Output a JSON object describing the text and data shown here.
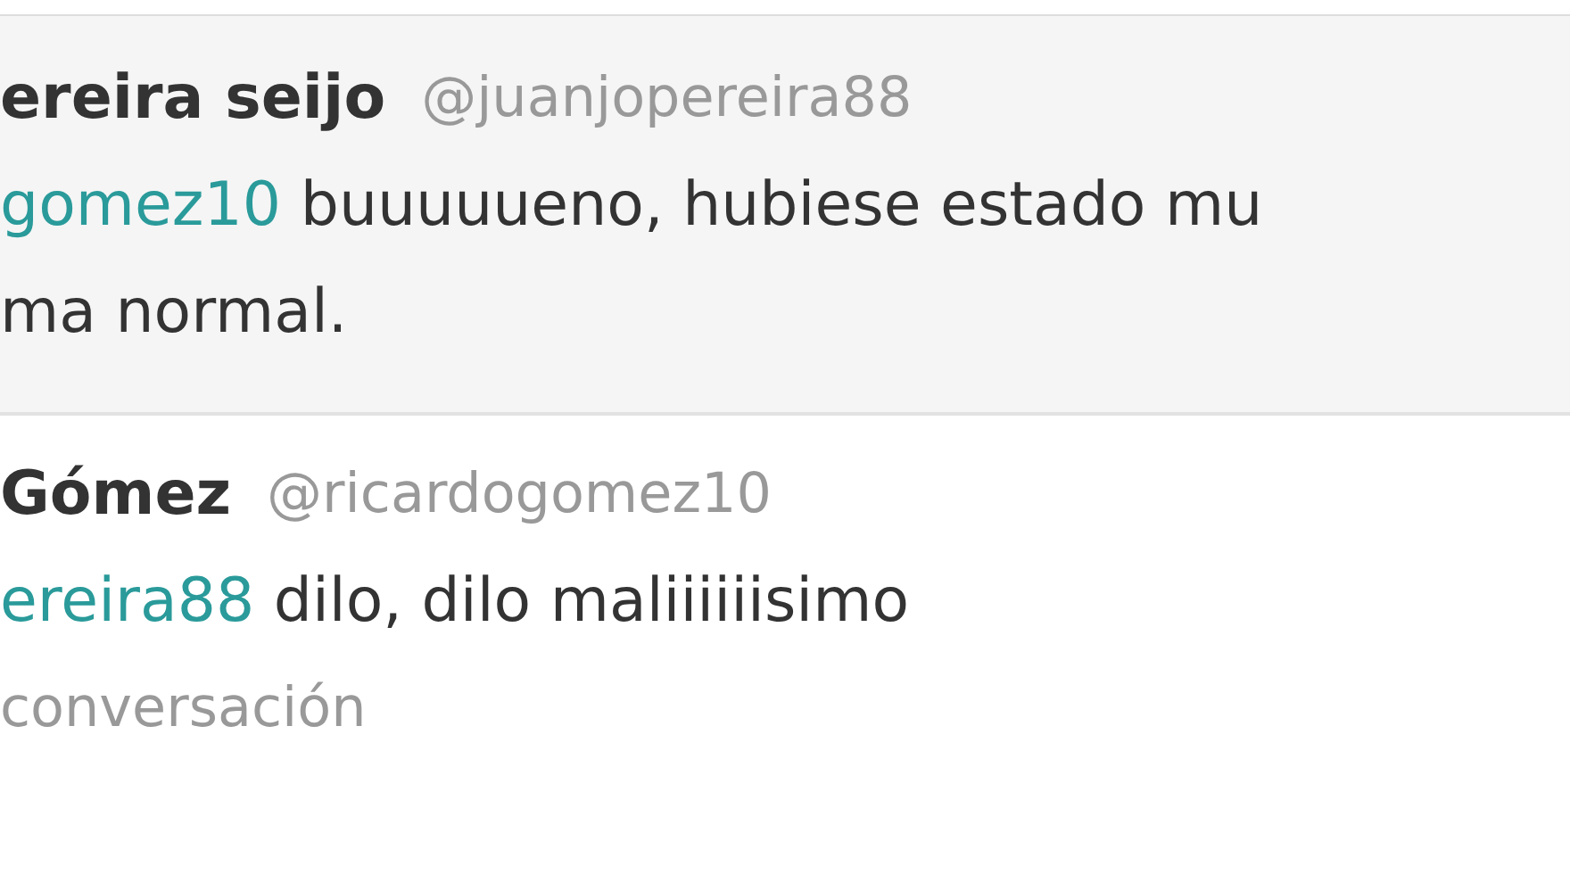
{
  "tweets": [
    {
      "highlighted": true,
      "name": "ereira seijo",
      "handle": "@juanjopereira88",
      "mention": "gomez10",
      "text_lines": [
        "buuuuueno, hubiese estado mu",
        "ma normal."
      ]
    },
    {
      "highlighted": false,
      "name": "Gómez",
      "handle": "@ricardogomez10",
      "mention": "ereira88",
      "text_lines": [
        "dilo, dilo maliiiiiisimo"
      ],
      "footer_link": "conversación"
    }
  ]
}
